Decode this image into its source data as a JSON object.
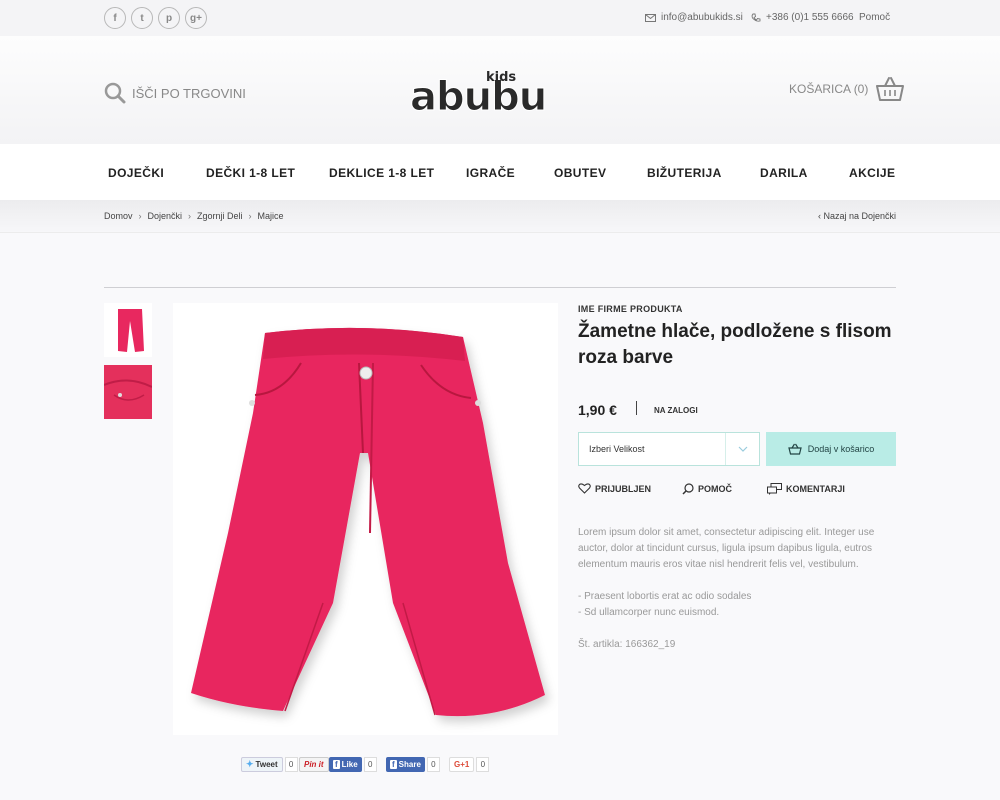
{
  "topbar": {
    "social": [
      {
        "glyph": "f",
        "icon": "facebook-icon"
      },
      {
        "glyph": "t",
        "icon": "twitter-icon"
      },
      {
        "glyph": "p",
        "icon": "pinterest-icon"
      },
      {
        "glyph": "g+",
        "icon": "google-plus-icon"
      }
    ],
    "email": "info@abubukids.si",
    "phone": "+386 (0)1 555 6666",
    "help": "Pomoč"
  },
  "header": {
    "search_label": "IŠČI PO TRGOVINI",
    "logo_main": "abubu",
    "logo_kids": "kids",
    "cart_label": "KOŠARICA (0)"
  },
  "nav": {
    "items": [
      "DOJEČKI",
      "DEČKI 1-8 LET",
      "DEKLICE 1-8 LET",
      "IGRAČE",
      "OBUTEV",
      "BIŽUTERIJA",
      "DARILA",
      "AKCIJE"
    ]
  },
  "breadcrumb": {
    "items": [
      "Domov",
      "Dojenčki",
      "Zgornji Deli",
      "Majice"
    ],
    "separator": "›",
    "back": "‹  Nazaj na Dojenčki"
  },
  "product": {
    "brand": "IME FIRME PRODUKTA",
    "title": "Žametne hlače, podložene s flisom roza barve",
    "price": "1,90 €",
    "stock": "NA ZALOGI",
    "size_placeholder": "Izberi Velikost",
    "add_to_cart": "Dodaj v košarico",
    "actions": {
      "favorite": "PRIJUBLJEN",
      "help": "POMOČ",
      "comments": "KOMENTARJI"
    },
    "description": "Lorem ipsum dolor sit amet, consectetur adipiscing elit. Integer  use auctor, dolor at tincidunt cursus, ligula ipsum dapibus ligula, eutros elementum mauris eros vitae nisl hendrerit felis vel, vestibulum.",
    "bullets": [
      "- Praesent lobortis erat ac odio sodales",
      "- Sd ullamcorper nunc euismod."
    ],
    "sku": "Št. artikla: 166362_19"
  },
  "share": {
    "tweet": "Tweet",
    "tweet_count": "0",
    "pin": "Pin it",
    "like": "Like",
    "like_count": "0",
    "fbshare": "Share",
    "fbshare_count": "0",
    "gplus": "G+1",
    "gplus_count": "0"
  },
  "colors": {
    "accent": "#b9ece6",
    "accent_border": "#b9e3dc",
    "product_pink": "#e8285f"
  }
}
